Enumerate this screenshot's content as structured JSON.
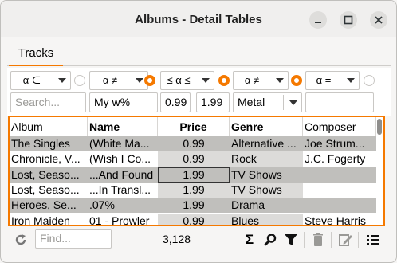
{
  "window": {
    "title": "Albums - Detail Tables"
  },
  "tabs": [
    {
      "label": "Tracks"
    }
  ],
  "filters": {
    "operators": [
      "α ∈",
      "α ≠",
      "≤ α ≤",
      "α ≠",
      "α ="
    ],
    "inputs": {
      "album": "Search...",
      "name": "My w%",
      "price_min": "0.99",
      "price_max": "1.99",
      "genre": "Metal",
      "composer": ""
    }
  },
  "table": {
    "columns": [
      "Album",
      "Name",
      "Price",
      "Genre",
      "Composer"
    ],
    "rows": [
      [
        "The Singles",
        "(White Ma...",
        "0.99",
        "Alternative ...",
        "Joe Strum..."
      ],
      [
        "Chronicle, V...",
        "(Wish I Co...",
        "0.99",
        "Rock",
        "J.C. Fogerty"
      ],
      [
        "Lost, Seaso...",
        "...And Found",
        "1.99",
        "TV Shows",
        ""
      ],
      [
        "Lost, Seaso...",
        "...In Transl...",
        "1.99",
        "TV Shows",
        ""
      ],
      [
        "Heroes, Se...",
        ".07%",
        "1.99",
        "Drama",
        ""
      ],
      [
        "Iron Maiden",
        "01 - Prowler",
        "0.99",
        "Blues",
        "Steve Harris"
      ]
    ]
  },
  "bottom": {
    "find_placeholder": "Find...",
    "record_count": "3,128"
  },
  "icons": {
    "refresh": "refresh-icon",
    "sum": "sum-icon",
    "search": "search-icon",
    "filter": "filter-icon",
    "delete": "trash-icon",
    "edit": "edit-icon",
    "menu": "list-menu-icon"
  },
  "colors": {
    "accent": "#f57900",
    "row_shade": "#c0bfbc",
    "col_shade": "#dcdbd9"
  }
}
